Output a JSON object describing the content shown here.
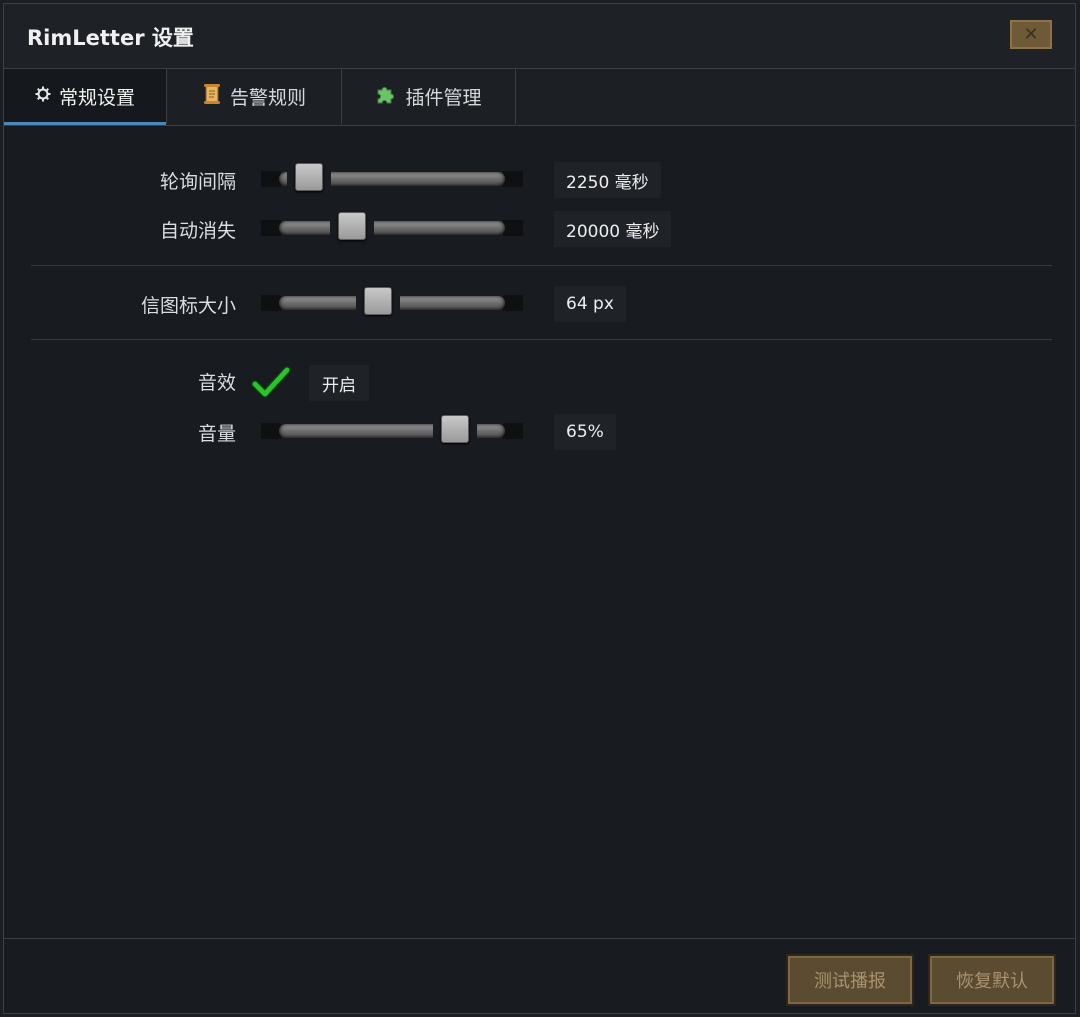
{
  "window": {
    "title": "RimLetter 设置",
    "close_label": "✕"
  },
  "tabs": [
    {
      "label": "常规设置",
      "icon": "gear-icon",
      "active": true
    },
    {
      "label": "告警规则",
      "icon": "scroll-icon",
      "active": false
    },
    {
      "label": "插件管理",
      "icon": "puzzle-icon",
      "active": false
    }
  ],
  "settings": {
    "poll_interval": {
      "label": "轮询间隔",
      "value": "2250 毫秒",
      "fraction": 0.08
    },
    "auto_dismiss": {
      "label": "自动消失",
      "value": "20000 毫秒",
      "fraction": 0.3
    },
    "icon_size": {
      "label": "信图标大小",
      "value": "64 px",
      "fraction": 0.43
    },
    "sound": {
      "label": "音效",
      "checked": true,
      "toggle_text": "开启"
    },
    "volume": {
      "label": "音量",
      "value": "65%",
      "fraction": 0.82
    }
  },
  "footer": {
    "test_button": "测试播报",
    "reset_button": "恢复默认"
  },
  "colors": {
    "accent": "#4d87b8",
    "check": "#27c22b",
    "button_bg": "#5b4b30"
  }
}
